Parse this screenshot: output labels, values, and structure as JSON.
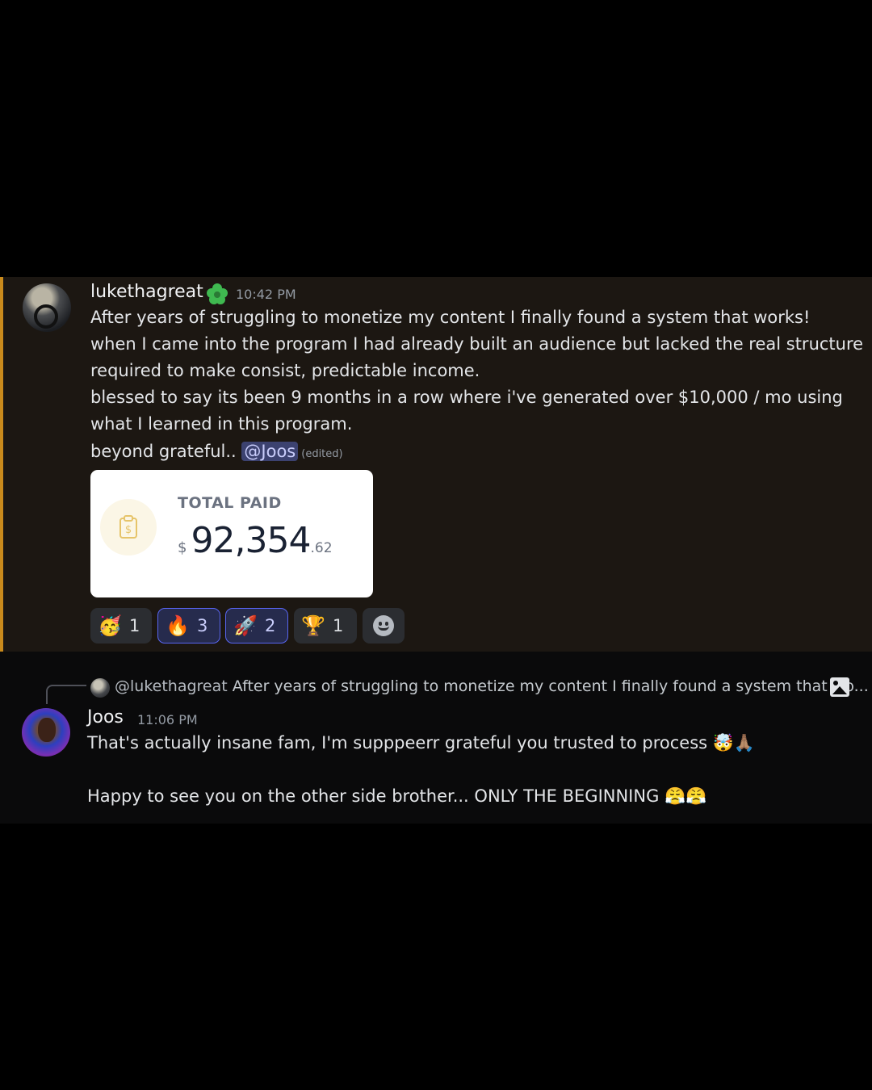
{
  "message1": {
    "username": "lukethagreat",
    "badge_icon": "green-flower-icon",
    "time": "10:42 PM",
    "lines": [
      "After years of struggling to monetize my content I finally found a system that works!",
      "when I came into the program I had already built an audience but lacked the real structure",
      "required to make consist, predictable income.",
      "blessed to say its been 9 months in a row where i've generated over $10,000 / mo using",
      "what I learned in this program.",
      "beyond grateful.."
    ],
    "mention": "@Joos",
    "edited": "(edited)",
    "card": {
      "label": "TOTAL PAID",
      "currency": "$",
      "amount": "92,354",
      "cents": ".62",
      "icon": "receipt-dollar-icon"
    },
    "reactions": [
      {
        "emoji": "🥳",
        "count": "1",
        "active": false
      },
      {
        "emoji": "🔥",
        "count": "3",
        "active": true
      },
      {
        "emoji": "🚀",
        "count": "2",
        "active": true
      },
      {
        "emoji": "🏆",
        "count": "1",
        "active": false
      }
    ],
    "add_reaction_icon": "smiley-add-reaction-icon"
  },
  "message2": {
    "reply_to": "@lukethagreat",
    "reply_preview": "After years of struggling to monetize my content I finally found a system that wo...",
    "reply_attachment_icon": "image-icon",
    "username": "Joos",
    "time": "11:06 PM",
    "line1": "That's actually insane fam, I'm supppeerr grateful you trusted to process ",
    "line1_emoji": "🤯🙏🏽",
    "line2": "Happy to see you on the other side brother... ONLY THE BEGINNING ",
    "line2_emoji": "😤😤"
  },
  "colors": {
    "highlight_bar": "#c98a1c",
    "highlight_bg": "#1c1712",
    "mention_bg": "#3c4270",
    "active_reaction_border": "#5865f2"
  }
}
